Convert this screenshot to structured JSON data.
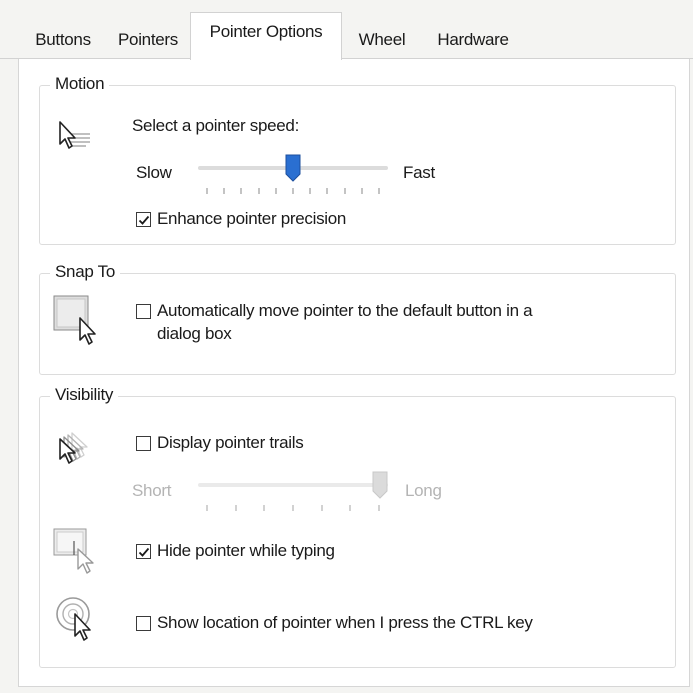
{
  "tabs": [
    {
      "label": "Buttons"
    },
    {
      "label": "Pointers"
    },
    {
      "label": "Pointer Options"
    },
    {
      "label": "Wheel"
    },
    {
      "label": "Hardware"
    }
  ],
  "active_tab": "Pointer Options",
  "motion": {
    "title": "Motion",
    "prompt": "Select a pointer speed:",
    "slow_label": "Slow",
    "fast_label": "Fast",
    "speed_level": 0.5,
    "enhance_precision": {
      "label": "Enhance pointer precision",
      "checked": true
    }
  },
  "snap_to": {
    "title": "Snap To",
    "option": {
      "label_line1": "Automatically move pointer to the default button in a",
      "label_line2": "dialog box",
      "checked": false
    }
  },
  "visibility": {
    "title": "Visibility",
    "trails": {
      "label": "Display pointer trails",
      "checked": false,
      "short_label": "Short",
      "long_label": "Long",
      "level": 1.0
    },
    "hide_typing": {
      "label": "Hide pointer while typing",
      "checked": true
    },
    "show_location": {
      "label": "Show location of pointer when I press the CTRL key",
      "checked": false
    }
  },
  "colors": {
    "slider_thumb": "#2a6fd1",
    "disabled_text": "#b4b4b4"
  },
  "icons": [
    "pointer-speed-icon",
    "snap-to-icon",
    "pointer-trails-icon",
    "hide-pointer-icon",
    "pointer-location-icon",
    "checkmark-icon"
  ]
}
